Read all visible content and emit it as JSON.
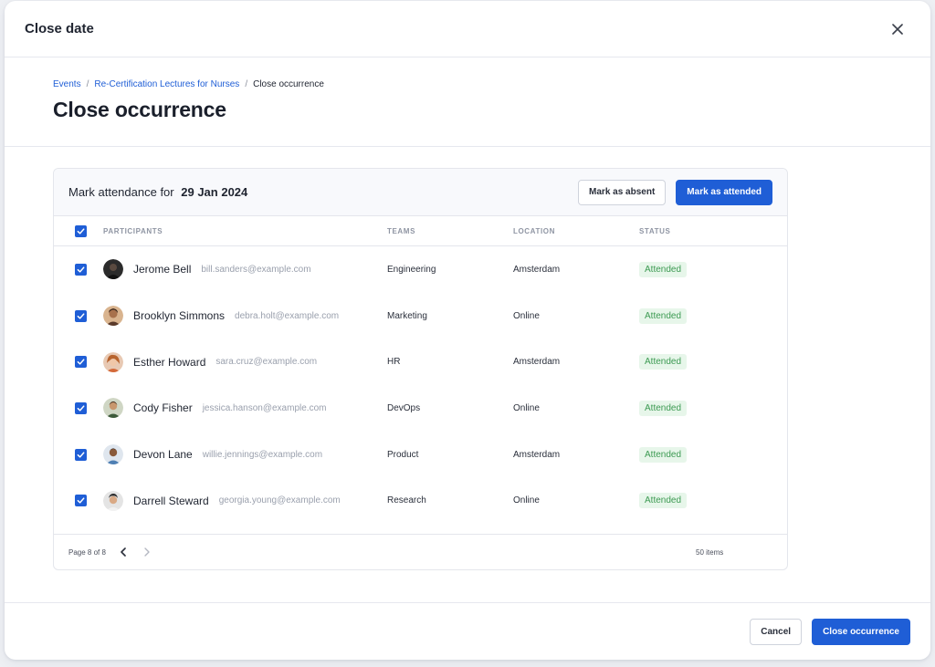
{
  "modal": {
    "title": "Close date"
  },
  "breadcrumb": {
    "items": [
      "Events",
      "Re-Certification Lectures for Nurses"
    ],
    "current": "Close occurrence",
    "sep": "/"
  },
  "page": {
    "title": "Close occurrence"
  },
  "attendance": {
    "label": "Mark attendance for",
    "date": "29 Jan 2024",
    "mark_absent": "Mark as absent",
    "mark_attended": "Mark as attended"
  },
  "table": {
    "headers": {
      "participants": "PARTICIPANTS",
      "teams": "TEAMS",
      "location": "LOCATION",
      "status": "STATUS"
    },
    "rows": [
      {
        "name": "Jerome Bell",
        "email": "bill.sanders@example.com",
        "team": "Engineering",
        "location": "Amsterdam",
        "status": "Attended"
      },
      {
        "name": "Brooklyn Simmons",
        "email": "debra.holt@example.com",
        "team": "Marketing",
        "location": "Online",
        "status": "Attended"
      },
      {
        "name": "Esther Howard",
        "email": "sara.cruz@example.com",
        "team": "HR",
        "location": "Amsterdam",
        "status": "Attended"
      },
      {
        "name": "Cody Fisher",
        "email": "jessica.hanson@example.com",
        "team": "DevOps",
        "location": "Online",
        "status": "Attended"
      },
      {
        "name": "Devon Lane",
        "email": "willie.jennings@example.com",
        "team": "Product",
        "location": "Amsterdam",
        "status": "Attended"
      },
      {
        "name": "Darrell Steward",
        "email": "georgia.young@example.com",
        "team": "Research",
        "location": "Online",
        "status": "Attended"
      }
    ]
  },
  "pagination": {
    "page_label": "Page 8 of 8",
    "items_label": "50 items"
  },
  "footer": {
    "cancel": "Cancel",
    "close_occurrence": "Close occurrence"
  },
  "colors": {
    "primary": "#1f5ed6",
    "success_bg": "#e7f6ea",
    "success_text": "#3c9a52"
  },
  "icons": {
    "close": "close-icon",
    "checkbox": "check-icon",
    "prev": "chevron-left-icon",
    "next": "chevron-right-icon"
  }
}
